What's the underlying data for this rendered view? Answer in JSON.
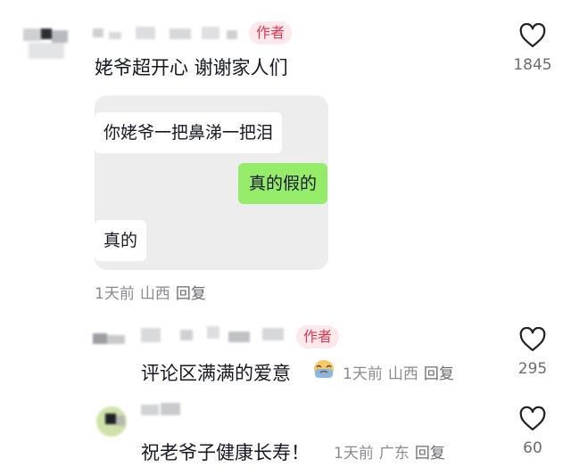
{
  "comments": [
    {
      "badge": "作者",
      "text": "姥爷超开心 谢谢家人们",
      "likes": "1845",
      "meta": {
        "time": "1天前",
        "location": "山西",
        "reply": "回复"
      },
      "screenshot": {
        "msg1": "你姥爷一把鼻涕一把泪",
        "msg2": "真的假的",
        "msg3": "真的"
      }
    },
    {
      "badge": "作者",
      "text": "评论区满满的爱意",
      "emoji": "crying-face-emoji",
      "likes": "295",
      "meta": {
        "time": "1天前",
        "location": "山西",
        "reply": "回复"
      }
    },
    {
      "text": "祝老爷子健康长寿！",
      "likes": "60",
      "meta": {
        "time": "1天前",
        "location": "广东",
        "reply": "回复"
      }
    }
  ],
  "icons": {
    "like": "heart-outline-icon"
  },
  "colors": {
    "badge_bg": "#fde8ec",
    "badge_text": "#e4364f",
    "wechat_green": "#95ec69",
    "meta": "#8a8b91"
  }
}
